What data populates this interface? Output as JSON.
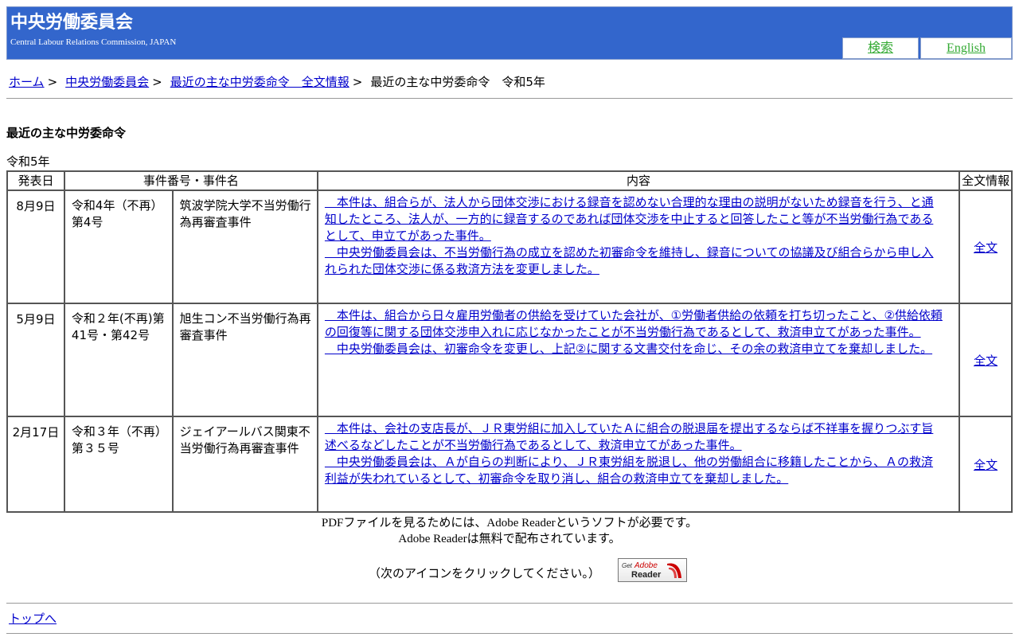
{
  "header": {
    "title": "中央労働委員会",
    "subtitle": "Central Labour Relations Commission, JAPAN",
    "search_label": "検索",
    "english_label": "English",
    "bg_color": "#3366cc",
    "link_color": "#33aa33"
  },
  "breadcrumb": {
    "items": [
      "ホーム",
      "中央労働委員会",
      "最近の主な中労委命令　全文情報"
    ],
    "separator": ">",
    "current": "最近の主な中労委命令　令和5年"
  },
  "page": {
    "heading": "最近の主な中労委命令",
    "year": "令和5年"
  },
  "table": {
    "headers": {
      "date": "発表日",
      "case": "事件番号・事件名",
      "content": "内容",
      "full_info": "全文情報"
    },
    "rows": [
      {
        "date": "8月9日",
        "case_no": "令和4年（不再）第4号",
        "case_name": "筑波学院大学不当労働行為再審査事件",
        "summary": "　本件は、組合らが、法人から団体交渉における録音を認めない合理的な理由の説明がないため録音を行う、と通知したところ、法人が、一方的に録音するのであれば団体交渉を中止すると回答したこと等が不当労働行為であるとして、申立てがあった事件。",
        "decision": "　中央労働委員会は、不当労働行為の成立を認めた初審命令を維持し、録音についての協議及び組合らから申し入れられた団体交渉に係る救済方法を変更しました。",
        "full": "全文"
      },
      {
        "date": "5月9日",
        "case_no": "令和２年(不再)第41号・第42号",
        "case_name": "旭生コン不当労働行為再審査事件",
        "summary": "　本件は、組合から日々雇用労働者の供給を受けていた会社が、①労働者供給の依頼を打ち切ったこと、②供給依頼の回復等に関する団体交渉申入れに応じなかったことが不当労働行為であるとして、救済申立てがあった事件。",
        "decision": "　中央労働委員会は、初審命令を変更し、上記②に関する文書交付を命じ、その余の救済申立てを棄却しました。",
        "full": "全文"
      },
      {
        "date": "2月17日",
        "case_no": "令和３年（不再）第３５号",
        "case_name": "ジェイアールバス関東不当労働行為再審査事件",
        "summary": "　本件は、会社の支店長が、ＪＲ東労組に加入していたＡに組合の脱退届を提出するならば不祥事を握りつぶす旨述べるなどしたことが不当労働行為であるとして、救済申立てがあった事件。",
        "decision": "　中央労働委員会は、Ａが自らの判断により、ＪＲ東労組を脱退し、他の労働組合に移籍したことから、Ａの救済利益が失われているとして、初審命令を取り消し、組合の救済申立てを棄却しました。",
        "full": "全文"
      }
    ]
  },
  "footer": {
    "pdf_line1": "PDFファイルを見るためには、Adobe Readerというソフトが必要です。",
    "pdf_line2": "Adobe Readerは無料で配布されています。",
    "click_note": "（次のアイコンをクリックしてください。）",
    "badge_get": "Get",
    "badge_adobe": "Adobe",
    "badge_reader": "Reader",
    "top_link": "トップへ"
  }
}
